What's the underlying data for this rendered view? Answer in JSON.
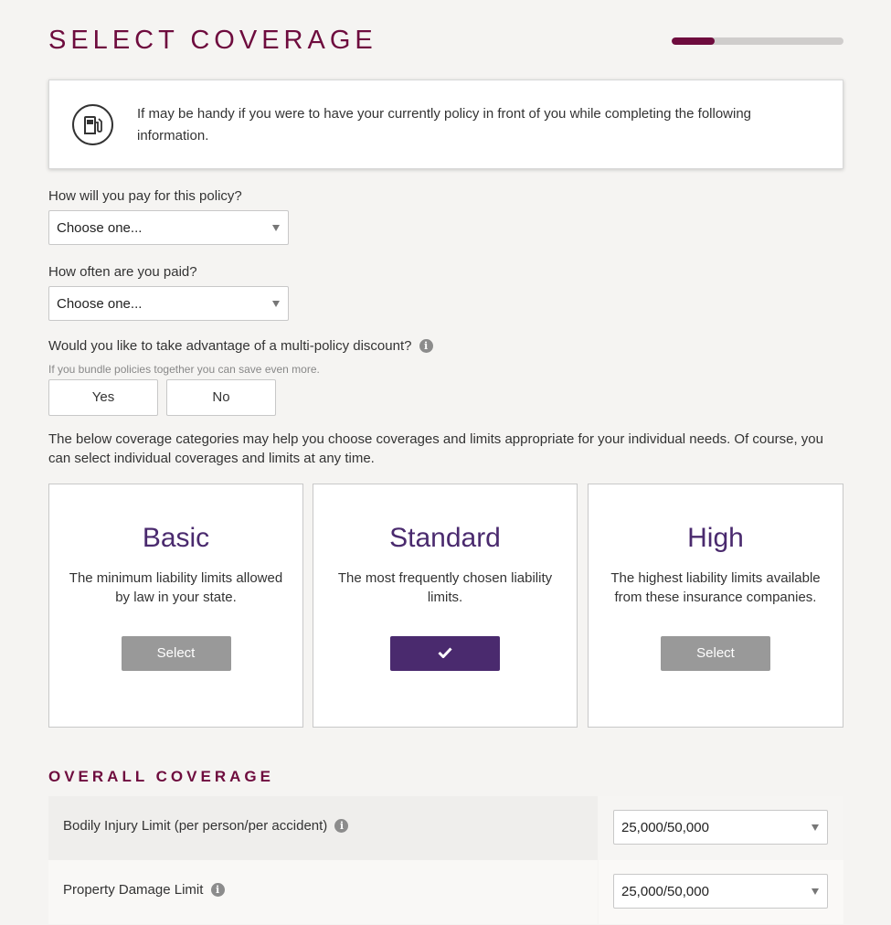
{
  "header": {
    "title": "SELECT COVERAGE",
    "progress": 0.25,
    "accent_color": "#6e0c3e"
  },
  "info": {
    "icon": "gas-pump-icon",
    "text": "If may be handy if you were to have your currently policy in front of you while completing the following information."
  },
  "form": {
    "payment": {
      "label": "How will you pay for this policy?",
      "value": "Choose one..."
    },
    "pay_frequency": {
      "label": "How often are you paid?",
      "value": "Choose one..."
    },
    "multi_policy": {
      "label": "Would you like to take advantage of a multi-policy discount?",
      "hint": "If you bundle policies together you can save even more.",
      "yes_label": "Yes",
      "no_label": "No"
    }
  },
  "coverage_intro": "The below coverage categories may help you choose coverages and limits appropriate for your individual needs. Of course, you can select individual coverages and limits at any time.",
  "plans": [
    {
      "title": "Basic",
      "description": "The minimum liability limits allowed by law in your state.",
      "button_label": "Select",
      "selected": false
    },
    {
      "title": "Standard",
      "description": "The most frequently chosen liability limits.",
      "button_label": "",
      "selected": true
    },
    {
      "title": "High",
      "description": "The highest liability limits available from these insurance companies.",
      "button_label": "Select",
      "selected": false
    }
  ],
  "overall": {
    "title": "OVERALL COVERAGE",
    "rows": [
      {
        "label": "Bodily Injury Limit (per person/per accident)",
        "value": "25,000/50,000"
      },
      {
        "label": "Property Damage Limit",
        "value": "25,000/50,000"
      }
    ]
  },
  "colors": {
    "plan_title": "#4a2a6e",
    "selected_button": "#4a2a6e",
    "unselected_button": "#999999"
  }
}
